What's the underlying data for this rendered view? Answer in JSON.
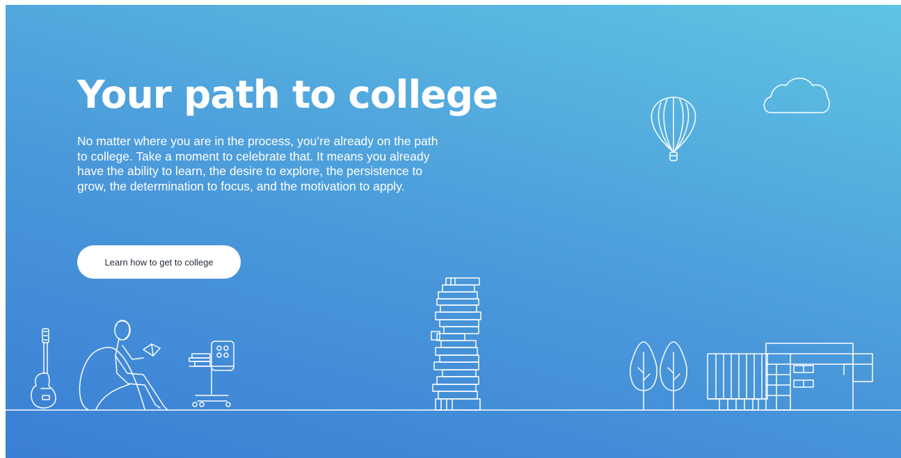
{
  "hero": {
    "title": "Your path to college",
    "body": "No matter where you are in the process, you’re already on the path to college. Take a moment to celebrate that. It means you already have the ability to learn, the desire to explore, the persistence to grow, the determination to focus, and the motivation to apply.",
    "cta_label": "Learn how to get to college"
  },
  "colors": {
    "gradient_start": "#3a7fd5",
    "gradient_end": "#5fc4e3",
    "line_art": "#ffffff",
    "button_background": "#ffffff",
    "button_text": "#1f2a36"
  },
  "illustrations": [
    "guitar-icon",
    "person-reading-beanbag-icon",
    "desk-chair-icon",
    "book-stack-icon",
    "hot-air-balloon-icon",
    "cloud-icon",
    "tree-icon",
    "college-building-icon"
  ]
}
